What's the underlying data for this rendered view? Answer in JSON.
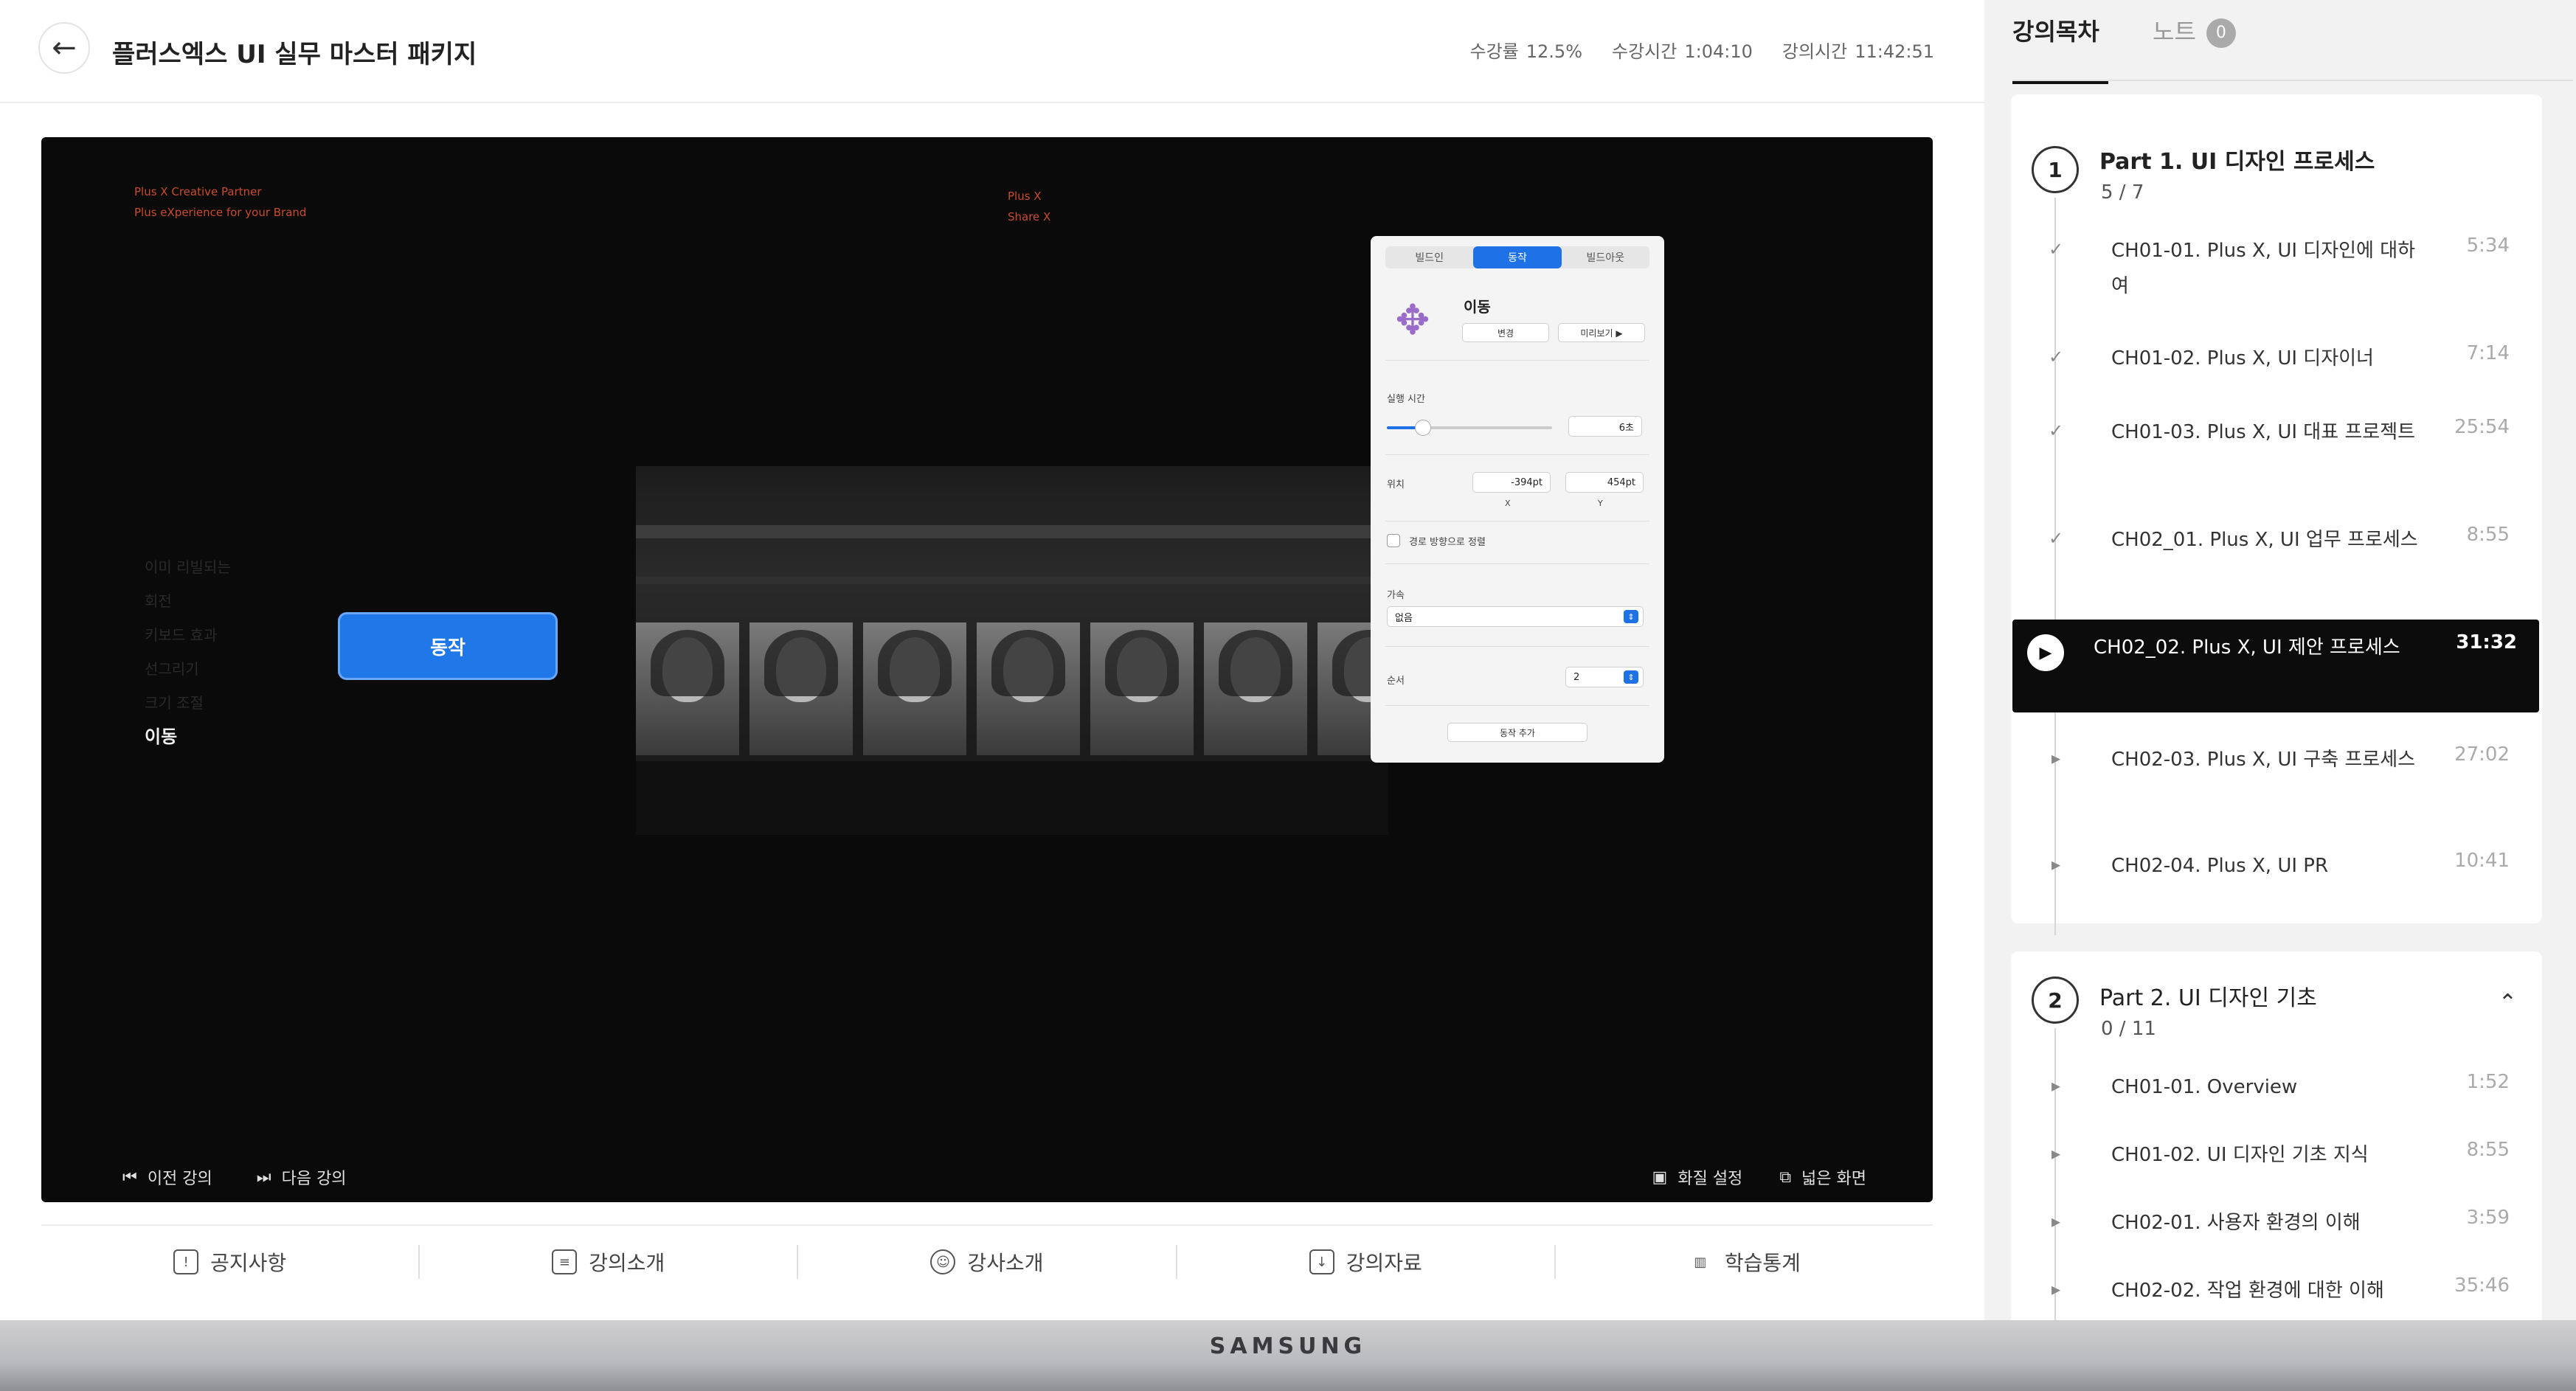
{
  "header": {
    "title": "플러스엑스 UI 실무 마스터 패키지",
    "stats": [
      {
        "label": "수강률",
        "value": "12.5%"
      },
      {
        "label": "수강시간",
        "value": "1:04:10"
      },
      {
        "label": "강의시간",
        "value": "11:42:51"
      }
    ]
  },
  "video": {
    "top_left_line1": "Plus X Creative Partner",
    "top_left_line2": "Plus eXperience for your Brand",
    "top_mid_line1": "Plus X",
    "top_mid_line2": "Share X",
    "menu_items": [
      "이미 리빌되는",
      "회전",
      "키보드 효과",
      "선그리기",
      "크기 조절"
    ],
    "menu_active": "이동",
    "action_button": "동작",
    "panel": {
      "tabs": [
        "빌드인",
        "동작",
        "빌드아웃"
      ],
      "active_tab": "동작",
      "effect_name": "이동",
      "change_btn": "변경",
      "preview_btn": "미리보기 ▶",
      "duration_label": "실행 시간",
      "duration_value": "6초",
      "duration_fraction": 0.22,
      "position_label": "위치",
      "pos_x": "-394pt",
      "pos_y": "454pt",
      "x_label": "X",
      "y_label": "Y",
      "align_path_label": "경로 방향으로 정렬",
      "accel_label": "가속",
      "accel_value": "없음",
      "order_label": "순서",
      "order_value": "2",
      "add_action_btn": "동작 추가"
    },
    "controls": {
      "prev": "이전 강의",
      "next": "다음 강의",
      "quality": "화질 설정",
      "wide": "넓은 화면"
    }
  },
  "bottom_tabs": [
    {
      "label": "공지사항",
      "icon": "notice-icon"
    },
    {
      "label": "강의소개",
      "icon": "clipboard-icon"
    },
    {
      "label": "강사소개",
      "icon": "person-icon"
    },
    {
      "label": "강의자료",
      "icon": "download-icon"
    },
    {
      "label": "학습통계",
      "icon": "stats-icon"
    }
  ],
  "sidebar": {
    "tab_curriculum": "강의목차",
    "tab_notes": "노트",
    "notes_count": "0",
    "parts": [
      {
        "num": "1",
        "title": "Part 1. UI 디자인 프로세스",
        "progress": "5 / 7",
        "lessons": [
          {
            "title": "CH01-01. Plus X, UI 디자인에 대하여",
            "time": "5:34",
            "state": "done"
          },
          {
            "title": "CH01-02. Plus X, UI 디자이너",
            "time": "7:14",
            "state": "done"
          },
          {
            "title": "CH01-03. Plus X, UI 대표 프로젝트",
            "time": "25:54",
            "state": "done"
          },
          {
            "title": "CH02_01. Plus X, UI 업무 프로세스",
            "time": "8:55",
            "state": "done"
          },
          {
            "title": "CH02_02. Plus X, UI 제안 프로세스",
            "time": "31:32",
            "state": "current"
          },
          {
            "title": "CH02-03. Plus X, UI 구축 프로세스",
            "time": "27:02",
            "state": "todo"
          },
          {
            "title": "CH02-04. Plus X, UI PR",
            "time": "10:41",
            "state": "todo"
          }
        ]
      },
      {
        "num": "2",
        "title": "Part 2. UI 디자인 기초",
        "progress": "0 / 11",
        "lessons": [
          {
            "title": "CH01-01. Overview",
            "time": "1:52",
            "state": "todo"
          },
          {
            "title": "CH01-02. UI 디자인 기초 지식",
            "time": "8:55",
            "state": "todo"
          },
          {
            "title": "CH02-01. 사용자 환경의 이해",
            "time": "3:59",
            "state": "todo"
          },
          {
            "title": "CH02-02. 작업 환경에 대한 이해",
            "time": "35:46",
            "state": "todo"
          }
        ]
      }
    ]
  },
  "monitor": {
    "brand": "SAMSUNG"
  },
  "colors": {
    "accent": "#1f77e8",
    "panel_accent": "#1e72e6",
    "current_bg": "#0c0c0c"
  }
}
